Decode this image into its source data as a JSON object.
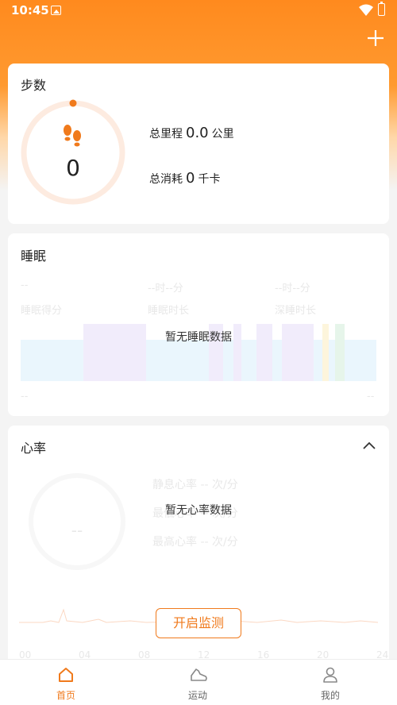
{
  "status_bar": {
    "time": "10:45",
    "icons": [
      "image-icon",
      "wifi-icon",
      "battery-icon"
    ]
  },
  "header": {
    "add_icon": "plus-icon",
    "background_color": "#ff8a1e"
  },
  "steps": {
    "title": "步数",
    "count": "0",
    "distance_label": "总里程",
    "distance_value": "0.0",
    "distance_unit": "公里",
    "calories_label": "总消耗",
    "calories_value": "0",
    "calories_unit": "千卡",
    "progress": 0,
    "accent_color": "#f07a1c"
  },
  "sleep": {
    "title": "睡眠",
    "score_value": "--",
    "score_label": "睡眠得分",
    "duration_value": "--时--分",
    "duration_label": "睡眠时长",
    "deep_value": "--时--分",
    "deep_label": "深睡时长",
    "axis_start": "--",
    "axis_end": "--",
    "empty_message": "暂无睡眠数据"
  },
  "heart_rate": {
    "title": "心率",
    "current_value": "--",
    "resting_label": "静息心率",
    "resting_value": "--",
    "avg_label": "最低心率",
    "avg_value": "--",
    "max_label": "最高心率",
    "max_value": "--",
    "unit": "次/分",
    "empty_message": "暂无心率数据",
    "monitor_button": "开启监测",
    "x_ticks": [
      "00",
      "04",
      "08",
      "12",
      "16",
      "20",
      "24"
    ]
  },
  "bottom_nav": {
    "items": [
      {
        "label": "首页",
        "icon": "home-icon",
        "active": true
      },
      {
        "label": "运动",
        "icon": "shoe-icon",
        "active": false
      },
      {
        "label": "我的",
        "icon": "person-icon",
        "active": false
      }
    ]
  }
}
